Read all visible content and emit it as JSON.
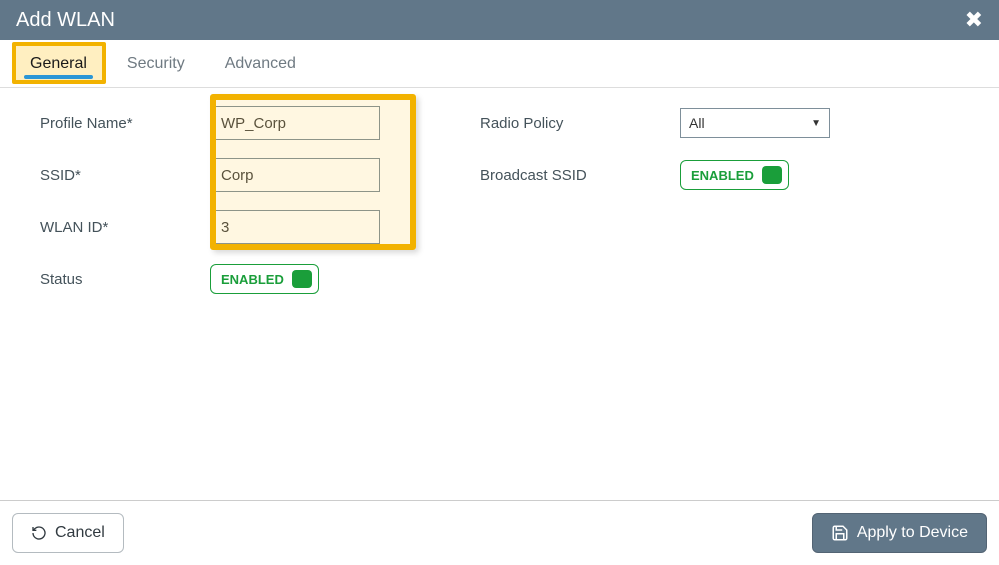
{
  "header": {
    "title": "Add WLAN"
  },
  "tabs": {
    "general": "General",
    "security": "Security",
    "advanced": "Advanced",
    "active": "general"
  },
  "form": {
    "profile_name_label": "Profile Name*",
    "profile_name_value": "WP_Corp",
    "ssid_label": "SSID*",
    "ssid_value": "Corp",
    "wlan_id_label": "WLAN ID*",
    "wlan_id_value": "3",
    "status_label": "Status",
    "status_toggle": "ENABLED",
    "radio_policy_label": "Radio Policy",
    "radio_policy_value": "All",
    "broadcast_ssid_label": "Broadcast SSID",
    "broadcast_ssid_toggle": "ENABLED"
  },
  "footer": {
    "cancel": "Cancel",
    "apply": "Apply to Device"
  }
}
